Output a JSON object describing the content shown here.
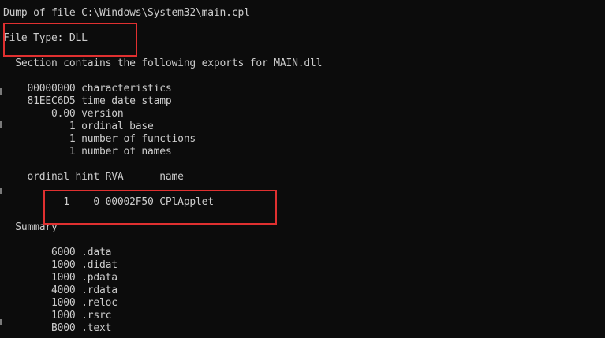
{
  "console": {
    "lines": [
      "Dump of file C:\\Windows\\System32\\main.cpl",
      "File Type: DLL",
      "  Section contains the following exports for MAIN.dll",
      "    00000000 characteristics",
      "    81EEC6D5 time date stamp",
      "        0.00 version",
      "           1 ordinal base",
      "           1 number of functions",
      "           1 number of names",
      "    ordinal hint RVA      name",
      "          1    0 00002F50 CPlApplet",
      "  Summary",
      "        6000 .data",
      "        1000 .didat",
      "        1000 .pdata",
      "        4000 .rdata",
      "        1000 .reloc",
      "        1000 .rsrc",
      "        B000 .text"
    ]
  },
  "colors": {
    "background": "#0c0c0c",
    "text": "#cccccc",
    "highlight": "#e03030"
  }
}
